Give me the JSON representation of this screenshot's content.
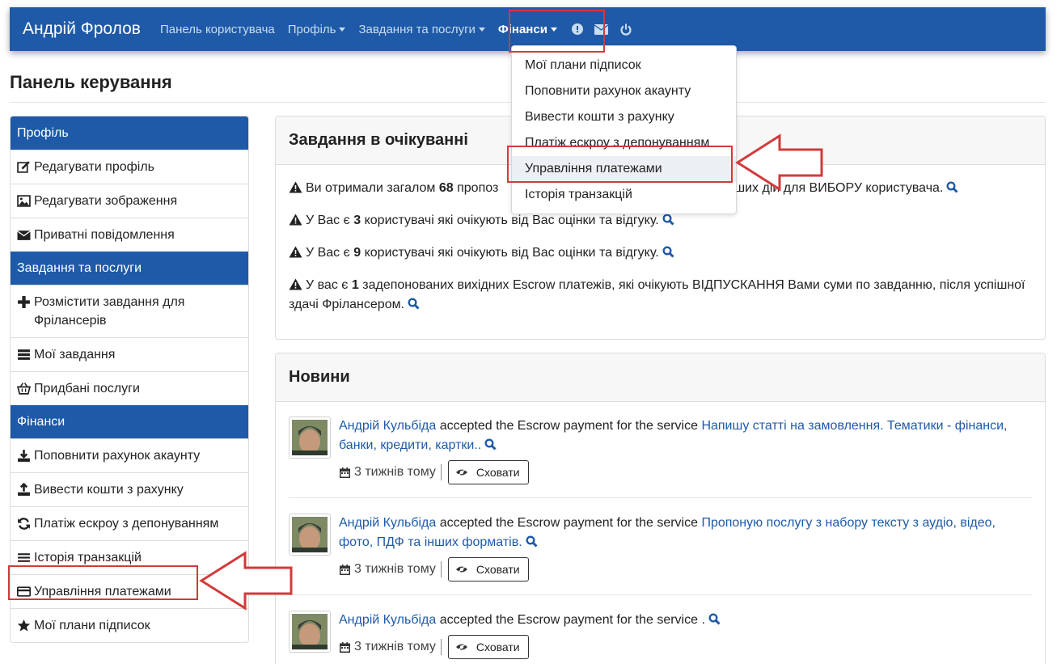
{
  "navbar": {
    "brand": "Андрій Фролов",
    "items": [
      {
        "label": "Панель користувача"
      },
      {
        "label": "Профіль"
      },
      {
        "label": "Завдання та послуги"
      },
      {
        "label": "Фінанси"
      }
    ],
    "icons": [
      "info-icon",
      "envelope-icon",
      "power-icon"
    ]
  },
  "page": {
    "title": "Панель керування"
  },
  "sidebar": {
    "sections": [
      {
        "title": "Профіль",
        "items": [
          {
            "label": "Редагувати профіль",
            "icon": "edit-icon"
          },
          {
            "label": "Редагувати зображення",
            "icon": "image-icon"
          },
          {
            "label": "Приватні повідомлення",
            "icon": "envelope-icon"
          }
        ]
      },
      {
        "title": "Завдання та послуги",
        "items": [
          {
            "label": "Розмістити завдання для Фрілансерів",
            "icon": "plus-icon"
          },
          {
            "label": "Мої завдання",
            "icon": "list-icon"
          },
          {
            "label": "Придбані послуги",
            "icon": "basket-icon"
          }
        ]
      },
      {
        "title": "Фінанси",
        "items": [
          {
            "label": "Поповнити рахунок акаунту",
            "icon": "download-icon"
          },
          {
            "label": "Вивести кошти з рахунку",
            "icon": "upload-icon"
          },
          {
            "label": "Платіж ескроу з депонуванням",
            "icon": "refresh-icon"
          },
          {
            "label": "Історія транзакцій",
            "icon": "bars-icon"
          },
          {
            "label": "Управління платежами",
            "icon": "credit-card-icon"
          },
          {
            "label": "Мої плани підписок",
            "icon": "star-icon"
          }
        ]
      }
    ]
  },
  "pending": {
    "title": "Завдання в очікуванні",
    "lines": [
      {
        "pre": "Ви отримали загалом ",
        "num": "68",
        "post": " пропоз",
        "tail": "ших дій для ВИБОРУ користувача."
      },
      {
        "pre": "У Вас є ",
        "num": "3",
        "post": " користувачі які очікують від Вас оцінки та відгуку."
      },
      {
        "pre": "У Вас є ",
        "num": "9",
        "post": " користувачі які очікують від Вас оцінки та відгуку."
      },
      {
        "pre": "У вас є ",
        "num": "1",
        "post": " задепонованих вихідних Escrow платежів, які очікують ВІДПУСКАННЯ Вами суми по завданню, після успішної здачі Фрілансером."
      }
    ]
  },
  "news": {
    "title": "Новини",
    "items": [
      {
        "user": "Андрій Кульбіда",
        "action": " accepted the Escrow payment for the service ",
        "service": "Напишу статті на замовлення. Тематики - фінанси, банки, кредити, картки..",
        "time": "3 тижнів тому",
        "hide_label": "Сховати"
      },
      {
        "user": "Андрій Кульбіда",
        "action": " accepted the Escrow payment for the service ",
        "service": "Пропоную послугу з набору тексту з аудіо, відео, фото, ПДФ та інших форматів.",
        "time": "3 тижнів тому",
        "hide_label": "Сховати"
      },
      {
        "user": "Андрій Кульбіда",
        "action": " accepted the Escrow payment for the service .",
        "service": "",
        "time": "3 тижнів тому",
        "hide_label": "Сховати"
      }
    ]
  },
  "dropdown": {
    "items": [
      {
        "label": "Мої плани підписок"
      },
      {
        "label": "Поповнити рахунок акаунту"
      },
      {
        "label": "Вивести кошти з рахунку"
      },
      {
        "label": "Платіж ескроу з депонуванням"
      },
      {
        "label": "Управління платежами"
      },
      {
        "label": "Історія транзакцій"
      }
    ]
  },
  "colors": {
    "navbar": "#1e5aa8",
    "link": "#1e5aa8",
    "annotation": "#d23a3a"
  }
}
